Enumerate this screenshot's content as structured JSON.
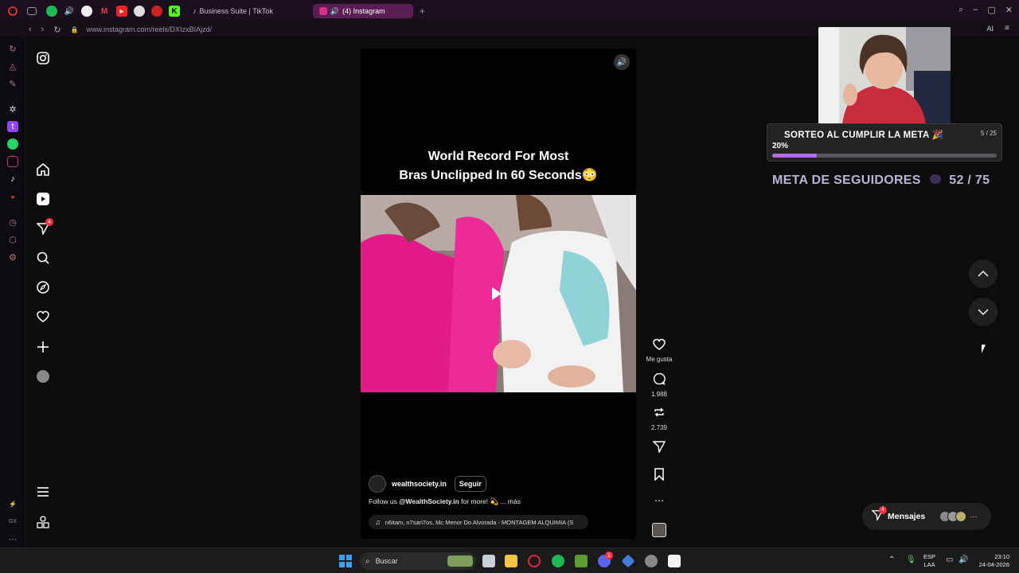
{
  "browser": {
    "tabs": [
      {
        "label": "Business Suite | TikTok"
      },
      {
        "label": "(4) Instagram"
      }
    ],
    "url": "www.instagram.com/reels/DXIzxBIAjzd/",
    "ai_label": "AI"
  },
  "nav": {
    "notifications_badge": "4"
  },
  "reel": {
    "title_line1": "World Record For Most",
    "title_line2": "Bras Unclipped In 60 Seconds😳",
    "username": "wealthsociety.in",
    "follow_label": "Seguir",
    "caption_prefix": "Follow us ",
    "caption_mention": "@WealthSociety.in",
    "caption_suffix": " for more! 💫 ... más",
    "music": "n6itam, n7sari7os, Mc Menor Do Alvorada - MONTAGEM ALQUIMIA (S"
  },
  "actions": {
    "like_label": "Me gusta",
    "comments": "1.988",
    "reposts": "2.739"
  },
  "overlay": {
    "sorteo_title": "SORTEO AL CUMPLIR LA META 🎉",
    "sorteo_count": "5 / 25",
    "sorteo_percent": "20%",
    "sorteo_progress": 0.2,
    "meta_label": "META DE SEGUIDORES",
    "meta_count": "52 / 75"
  },
  "messages": {
    "label": "Mensajes",
    "badge": "4"
  },
  "taskbar": {
    "search_label": "Buscar",
    "lang_line1": "ESP",
    "lang_line2": "LAA",
    "time": "23:10",
    "date": "24-04-2026",
    "discord_badge": "1"
  }
}
